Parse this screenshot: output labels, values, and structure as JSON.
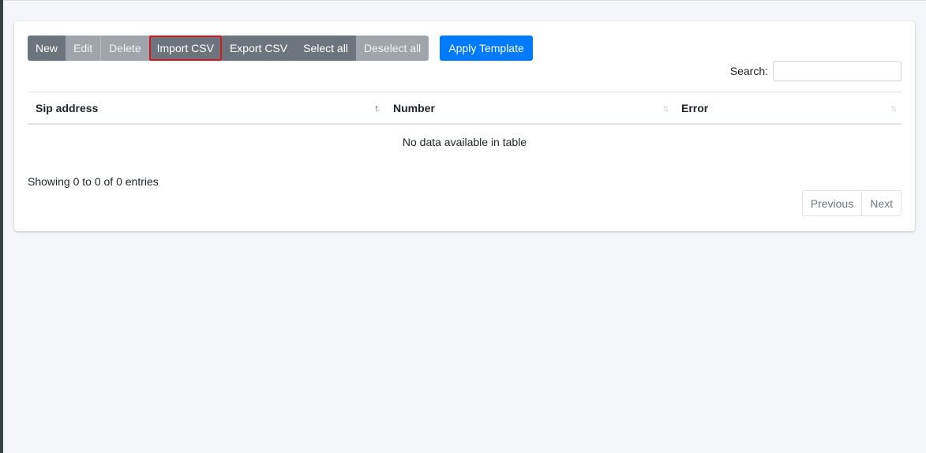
{
  "toolbar": {
    "new": "New",
    "edit": "Edit",
    "delete": "Delete",
    "import_csv": "Import CSV",
    "export_csv": "Export CSV",
    "select_all": "Select all",
    "deselect_all": "Deselect all",
    "apply_template": "Apply Template"
  },
  "search": {
    "label": "Search:",
    "value": "",
    "placeholder": ""
  },
  "table": {
    "columns": [
      "Sip address",
      "Number",
      "Error"
    ],
    "empty_message": "No data available in table"
  },
  "footer": {
    "info": "Showing 0 to 0 of 0 entries",
    "previous": "Previous",
    "next": "Next"
  },
  "colors": {
    "primary": "#007bff",
    "button_dark": "#6c757d",
    "button_disabled": "#9fa5aa",
    "highlight": "#d9161b",
    "background": "#f4f6f9"
  }
}
